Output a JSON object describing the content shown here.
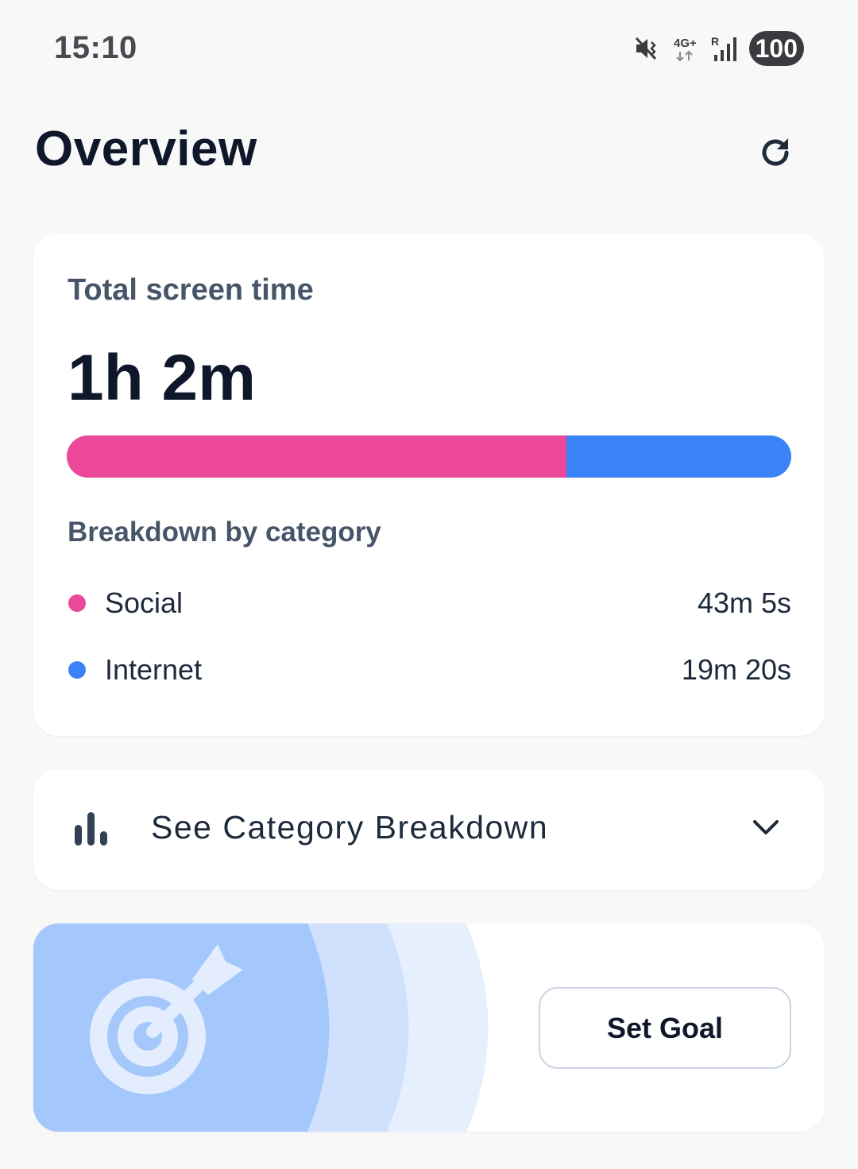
{
  "status_bar": {
    "time": "15:10",
    "network_label": "4G+",
    "roaming_label": "R",
    "battery": "100",
    "icons": [
      "mute-icon",
      "network-4g-icon",
      "signal-icon",
      "battery-icon"
    ]
  },
  "header": {
    "title": "Overview",
    "refresh_icon": "refresh-icon"
  },
  "total_card": {
    "label": "Total screen time",
    "value": "1h 2m",
    "breakdown_title": "Breakdown by category",
    "usage_fraction": [
      0.69,
      0.31
    ],
    "categories": [
      {
        "name": "Social",
        "time": "43m 5s",
        "color": "#ec4899"
      },
      {
        "name": "Internet",
        "time": "19m 20s",
        "color": "#3b82f6"
      }
    ]
  },
  "expand_card": {
    "label": "See Category Breakdown",
    "icon": "bar-chart-icon",
    "chevron": "chevron-down-icon"
  },
  "goal_card": {
    "icon": "target-arrow-icon",
    "button_label": "Set Goal",
    "colors": [
      "#a4c8fb",
      "#cfe1fc",
      "#e5effd"
    ]
  }
}
